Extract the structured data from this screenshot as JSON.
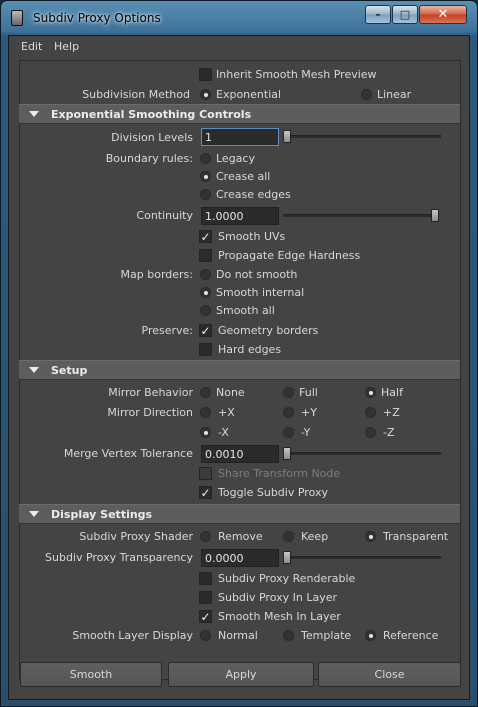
{
  "window": {
    "title": "Subdiv Proxy Options",
    "minimize": "–",
    "maximize": "□",
    "close": "✕"
  },
  "menu": [
    "Edit",
    "Help"
  ],
  "top": {
    "inherit_label": "Inherit Smooth Mesh Preview",
    "inherit_checked": false,
    "subdiv_method_label": "Subdivision Method",
    "subdiv_method_options": [
      "Exponential",
      "Linear"
    ],
    "subdiv_method_selected": "Exponential"
  },
  "sections": {
    "exponential": "Exponential Smoothing Controls",
    "setup": "Setup",
    "display": "Display Settings"
  },
  "exponential": {
    "division_levels_label": "Division Levels",
    "division_levels_value": "1",
    "boundary_label": "Boundary rules:",
    "boundary_options": [
      "Legacy",
      "Crease all",
      "Crease edges"
    ],
    "boundary_selected": "Crease all",
    "continuity_label": "Continuity",
    "continuity_value": "1.0000",
    "smooth_uvs_label": "Smooth UVs",
    "smooth_uvs_checked": true,
    "propagate_label": "Propagate Edge Hardness",
    "propagate_checked": false,
    "map_borders_label": "Map borders:",
    "map_border_options": [
      "Do not smooth",
      "Smooth internal",
      "Smooth all"
    ],
    "map_border_selected": "Smooth internal",
    "preserve_label": "Preserve:",
    "geometry_borders_label": "Geometry borders",
    "geometry_borders_checked": true,
    "hard_edges_label": "Hard edges",
    "hard_edges_checked": false
  },
  "setup": {
    "mirror_behavior_label": "Mirror Behavior",
    "mirror_behavior_options": [
      "None",
      "Full",
      "Half"
    ],
    "mirror_behavior_selected": "Half",
    "mirror_direction_label": "Mirror Direction",
    "mirror_direction_options": [
      "+X",
      "+Y",
      "+Z",
      "-X",
      "-Y",
      "-Z"
    ],
    "mirror_direction_selected": "-X",
    "merge_label": "Merge Vertex Tolerance",
    "merge_value": "0.0010",
    "share_transform_label": "Share Transform Node",
    "share_transform_checked": false,
    "toggle_proxy_label": "Toggle Subdiv Proxy",
    "toggle_proxy_checked": true
  },
  "display": {
    "shader_label": "Subdiv Proxy Shader",
    "shader_options": [
      "Remove",
      "Keep",
      "Transparent"
    ],
    "shader_selected": "Transparent",
    "transparency_label": "Subdiv Proxy Transparency",
    "transparency_value": "0.0000",
    "renderable_label": "Subdiv Proxy Renderable",
    "renderable_checked": false,
    "in_layer_label": "Subdiv Proxy In Layer",
    "in_layer_checked": false,
    "smooth_mesh_layer_label": "Smooth Mesh In Layer",
    "smooth_mesh_layer_checked": true,
    "smooth_layer_display_label": "Smooth Layer Display",
    "smooth_layer_display_options": [
      "Normal",
      "Template",
      "Reference"
    ],
    "smooth_layer_display_selected": "Reference"
  },
  "buttons": {
    "smooth": "Smooth",
    "apply": "Apply",
    "close": "Close"
  },
  "sliders": {
    "division_levels": 0.0,
    "continuity": 1.0,
    "merge_tolerance": 0.0,
    "transparency": 0.0
  },
  "icons": {
    "app": "maya-icon",
    "section": "triangle-down-icon",
    "check": "checkmark-icon"
  }
}
